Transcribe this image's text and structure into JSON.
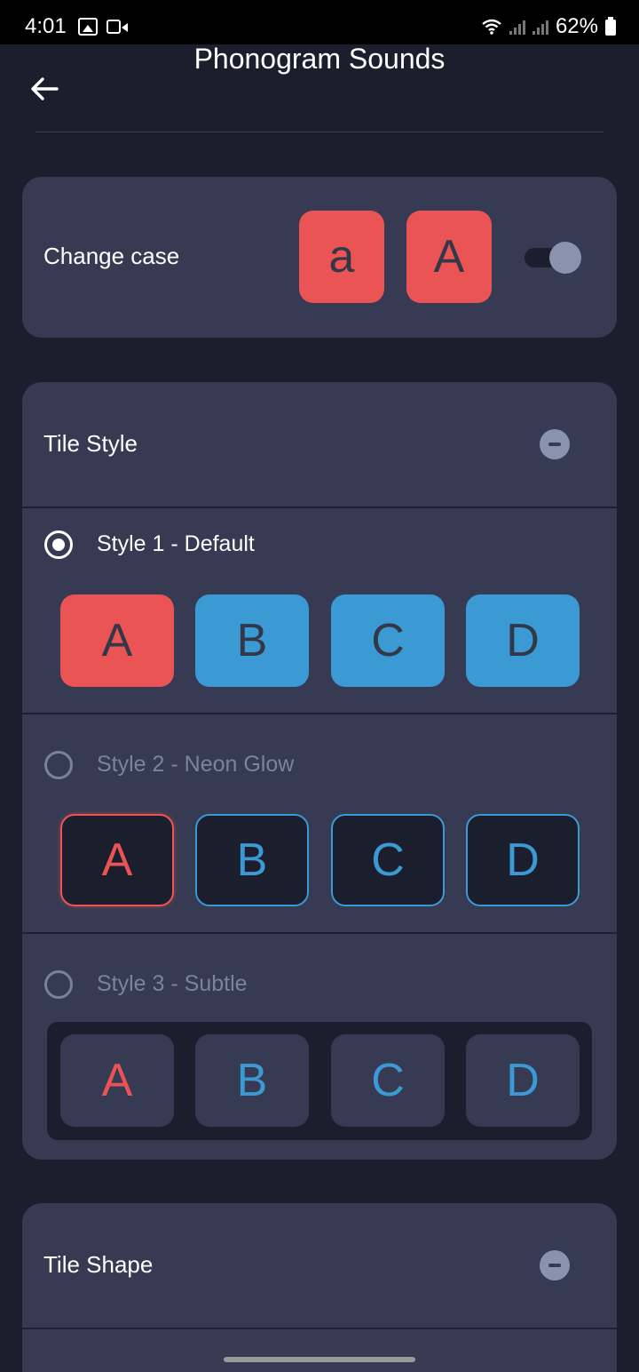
{
  "status_bar": {
    "time": "4:01",
    "battery": "62%"
  },
  "header": {
    "title": "Phonogram Sounds"
  },
  "change_case": {
    "label": "Change case",
    "lower_tile": "a",
    "upper_tile": "A",
    "toggle_on": true
  },
  "tile_style": {
    "title": "Tile Style",
    "options": [
      {
        "label": "Style 1 - Default",
        "selected": true,
        "tiles": [
          "A",
          "B",
          "C",
          "D"
        ]
      },
      {
        "label": "Style 2 - Neon Glow",
        "selected": false,
        "tiles": [
          "A",
          "B",
          "C",
          "D"
        ]
      },
      {
        "label": "Style 3 - Subtle",
        "selected": false,
        "tiles": [
          "A",
          "B",
          "C",
          "D"
        ]
      }
    ]
  },
  "tile_shape": {
    "title": "Tile Shape"
  },
  "colors": {
    "background": "#1b1e2d",
    "card": "#363a52",
    "red": "#ea5455",
    "blue": "#3b99d4"
  },
  "icons": {
    "back": "arrow-left-icon",
    "collapse": "minus-circle-icon"
  }
}
